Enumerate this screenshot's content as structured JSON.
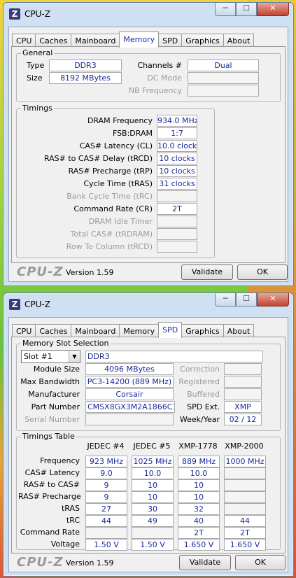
{
  "window1": {
    "title": "CPU-Z",
    "controls": {
      "minimize": "─",
      "maximize": "☐",
      "close": "✕"
    },
    "tabs": [
      "CPU",
      "Caches",
      "Mainboard",
      "Memory",
      "SPD",
      "Graphics",
      "About"
    ],
    "active_tab": "Memory",
    "general": {
      "title": "General",
      "type_label": "Type",
      "type_value": "DDR3",
      "size_label": "Size",
      "size_value": "8192 MBytes",
      "channels_label": "Channels #",
      "channels_value": "Dual",
      "dcmode_label": "DC Mode",
      "dcmode_value": "",
      "nbfreq_label": "NB Frequency",
      "nbfreq_value": ""
    },
    "timings": {
      "title": "Timings",
      "rows": [
        {
          "label": "DRAM Frequency",
          "value": "934.0 MHz",
          "enabled": true
        },
        {
          "label": "FSB:DRAM",
          "value": "1:7",
          "enabled": true
        },
        {
          "label": "CAS# Latency (CL)",
          "value": "10.0 clocks",
          "enabled": true
        },
        {
          "label": "RAS# to CAS# Delay (tRCD)",
          "value": "10 clocks",
          "enabled": true
        },
        {
          "label": "RAS# Precharge (tRP)",
          "value": "10 clocks",
          "enabled": true
        },
        {
          "label": "Cycle Time (tRAS)",
          "value": "31 clocks",
          "enabled": true
        },
        {
          "label": "Bank Cycle Time (tRC)",
          "value": "",
          "enabled": false
        },
        {
          "label": "Command Rate (CR)",
          "value": "2T",
          "enabled": true
        },
        {
          "label": "DRAM Idle Timer",
          "value": "",
          "enabled": false
        },
        {
          "label": "Total CAS# (tRDRAM)",
          "value": "",
          "enabled": false
        },
        {
          "label": "Row To Column (tRCD)",
          "value": "",
          "enabled": false
        }
      ]
    },
    "footer": {
      "logo": "CPU-Z",
      "version": "Version 1.59",
      "validate": "Validate",
      "ok": "OK"
    }
  },
  "window2": {
    "title": "CPU-Z",
    "controls": {
      "minimize": "─",
      "maximize": "☐",
      "close": "✕"
    },
    "tabs": [
      "CPU",
      "Caches",
      "Mainboard",
      "Memory",
      "SPD",
      "Graphics",
      "About"
    ],
    "active_tab": "SPD",
    "slot": {
      "title": "Memory Slot Selection",
      "selected": "Slot #1",
      "type": "DDR3",
      "module_size_label": "Module Size",
      "module_size": "4096 MBytes",
      "max_bw_label": "Max Bandwidth",
      "max_bw": "PC3-14200 (889 MHz)",
      "manufacturer_label": "Manufacturer",
      "manufacturer": "Corsair",
      "part_label": "Part Number",
      "part": "CMSX8GX3M2A1866C10",
      "serial_label": "Serial Number",
      "serial": "",
      "correction_label": "Correction",
      "correction": "",
      "registered_label": "Registered",
      "registered": "",
      "buffered_label": "Buffered",
      "buffered": "",
      "spd_ext_label": "SPD Ext.",
      "spd_ext": "XMP",
      "weekyear_label": "Week/Year",
      "weekyear": "02 / 12"
    },
    "timings_table": {
      "title": "Timings Table",
      "columns": [
        "JEDEC #4",
        "JEDEC #5",
        "XMP-1778",
        "XMP-2000"
      ],
      "rows": [
        {
          "label": "Frequency",
          "values": [
            "923 MHz",
            "1025 MHz",
            "889 MHz",
            "1000 MHz"
          ]
        },
        {
          "label": "CAS# Latency",
          "values": [
            "9.0",
            "10.0",
            "10.0",
            ""
          ]
        },
        {
          "label": "RAS# to CAS#",
          "values": [
            "9",
            "10",
            "10",
            ""
          ]
        },
        {
          "label": "RAS# Precharge",
          "values": [
            "9",
            "10",
            "10",
            ""
          ]
        },
        {
          "label": "tRAS",
          "values": [
            "27",
            "30",
            "32",
            ""
          ]
        },
        {
          "label": "tRC",
          "values": [
            "44",
            "49",
            "40",
            "44"
          ]
        },
        {
          "label": "Command Rate",
          "values": [
            "",
            "",
            "2T",
            "2T"
          ]
        },
        {
          "label": "Voltage",
          "values": [
            "1.50 V",
            "1.50 V",
            "1.650 V",
            "1.650 V"
          ]
        }
      ]
    },
    "footer": {
      "logo": "CPU-Z",
      "version": "Version 1.59",
      "validate": "Validate",
      "ok": "OK"
    }
  }
}
